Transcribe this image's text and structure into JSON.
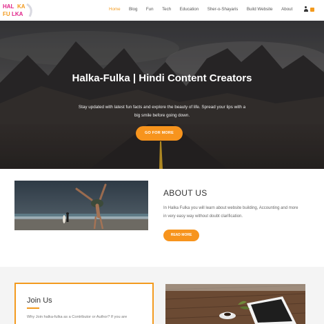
{
  "logo": {
    "lines": [
      "HALKA",
      "FULKA"
    ]
  },
  "nav": {
    "items": [
      {
        "label": "Home",
        "active": true
      },
      {
        "label": "Blog",
        "active": false
      },
      {
        "label": "Fun",
        "active": false
      },
      {
        "label": "Tech",
        "active": false
      },
      {
        "label": "Education",
        "active": false
      },
      {
        "label": "Sher-o-Shayaris",
        "active": false
      },
      {
        "label": "Build Website",
        "active": false
      },
      {
        "label": "About",
        "active": false
      }
    ],
    "icons": [
      "user-icon",
      "cart-icon"
    ]
  },
  "hero": {
    "title": "Halka-Fulka | Hindi Content Creators",
    "subtitle": "Stay updated with latest fun facts and explore the beauty of life. Spread your lips with a big smile before going down.",
    "button": "GO FOR MORE"
  },
  "about": {
    "heading": "ABOUT US",
    "text": "In Halka Fulka you will learn about website building, Accounting and more in very easy way without doubt clarification.",
    "button": "READ MORE"
  },
  "join": {
    "heading": "Join Us",
    "text": "Why Join halka-fulka as a Contributor or Author? If you are"
  },
  "colors": {
    "accent": "#f7941d",
    "nav_active": "#f39a1e",
    "logo_pink": "#e0248a"
  }
}
